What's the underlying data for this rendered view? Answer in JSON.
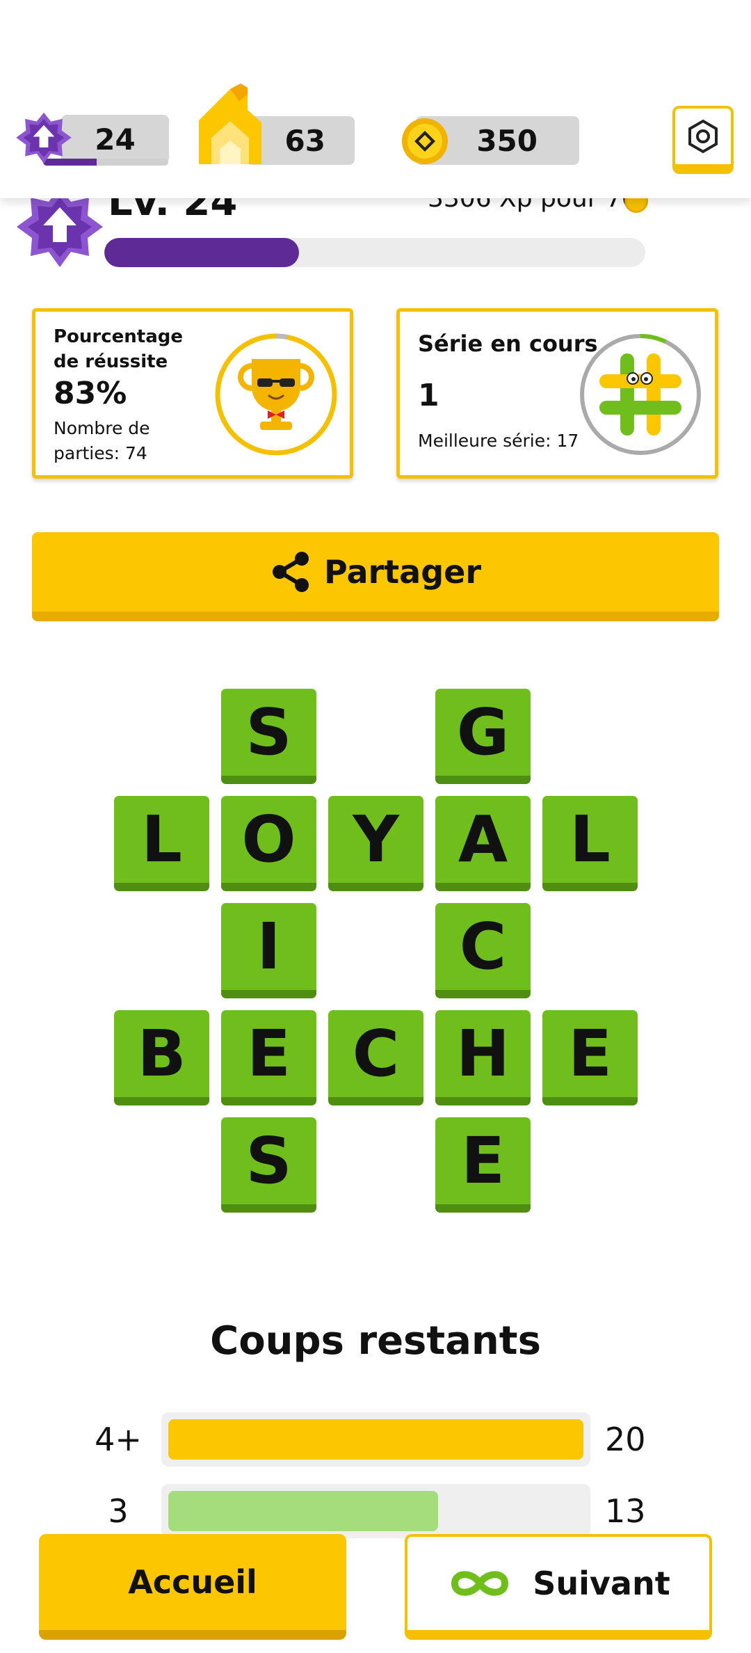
{
  "header": {
    "level_value": "24",
    "level_progress": 0.43,
    "streak_value": "63",
    "coins_value": "350"
  },
  "level_section": {
    "level_label": "Lv. 24",
    "xp_text": "3306 Xp pour 70",
    "progress": 0.36
  },
  "cards": {
    "success": {
      "title": "Pourcentage de réussite",
      "value": "83%",
      "games_label": "Nombre de parties: 74"
    },
    "streak": {
      "title": "Série en cours",
      "value": "1",
      "best_label": "Meilleure série: 17"
    }
  },
  "share": {
    "label": "Partager"
  },
  "grid": {
    "tiles": [
      {
        "letter": "S",
        "row": 0,
        "col": 1
      },
      {
        "letter": "G",
        "row": 0,
        "col": 3
      },
      {
        "letter": "L",
        "row": 1,
        "col": 0
      },
      {
        "letter": "O",
        "row": 1,
        "col": 1
      },
      {
        "letter": "Y",
        "row": 1,
        "col": 2
      },
      {
        "letter": "A",
        "row": 1,
        "col": 3
      },
      {
        "letter": "L",
        "row": 1,
        "col": 4
      },
      {
        "letter": "I",
        "row": 2,
        "col": 1
      },
      {
        "letter": "C",
        "row": 2,
        "col": 3
      },
      {
        "letter": "B",
        "row": 3,
        "col": 0
      },
      {
        "letter": "E",
        "row": 3,
        "col": 1
      },
      {
        "letter": "C",
        "row": 3,
        "col": 2
      },
      {
        "letter": "H",
        "row": 3,
        "col": 3
      },
      {
        "letter": "E",
        "row": 3,
        "col": 4
      },
      {
        "letter": "S",
        "row": 4,
        "col": 1
      },
      {
        "letter": "E",
        "row": 4,
        "col": 3
      }
    ]
  },
  "moves_left": {
    "title": "Coups restants",
    "rows": [
      {
        "label": "4+",
        "value": "20",
        "fraction": 1.0,
        "color": "#fcc600"
      },
      {
        "label": "3",
        "value": "13",
        "fraction": 0.65,
        "color": "#a5dc7c"
      }
    ]
  },
  "bottom": {
    "home_label": "Accueil",
    "next_label": "Suivant"
  },
  "colors": {
    "accent_yellow": "#fcc600",
    "purple": "#5e2a96",
    "tile_green": "#6fbe1b"
  }
}
